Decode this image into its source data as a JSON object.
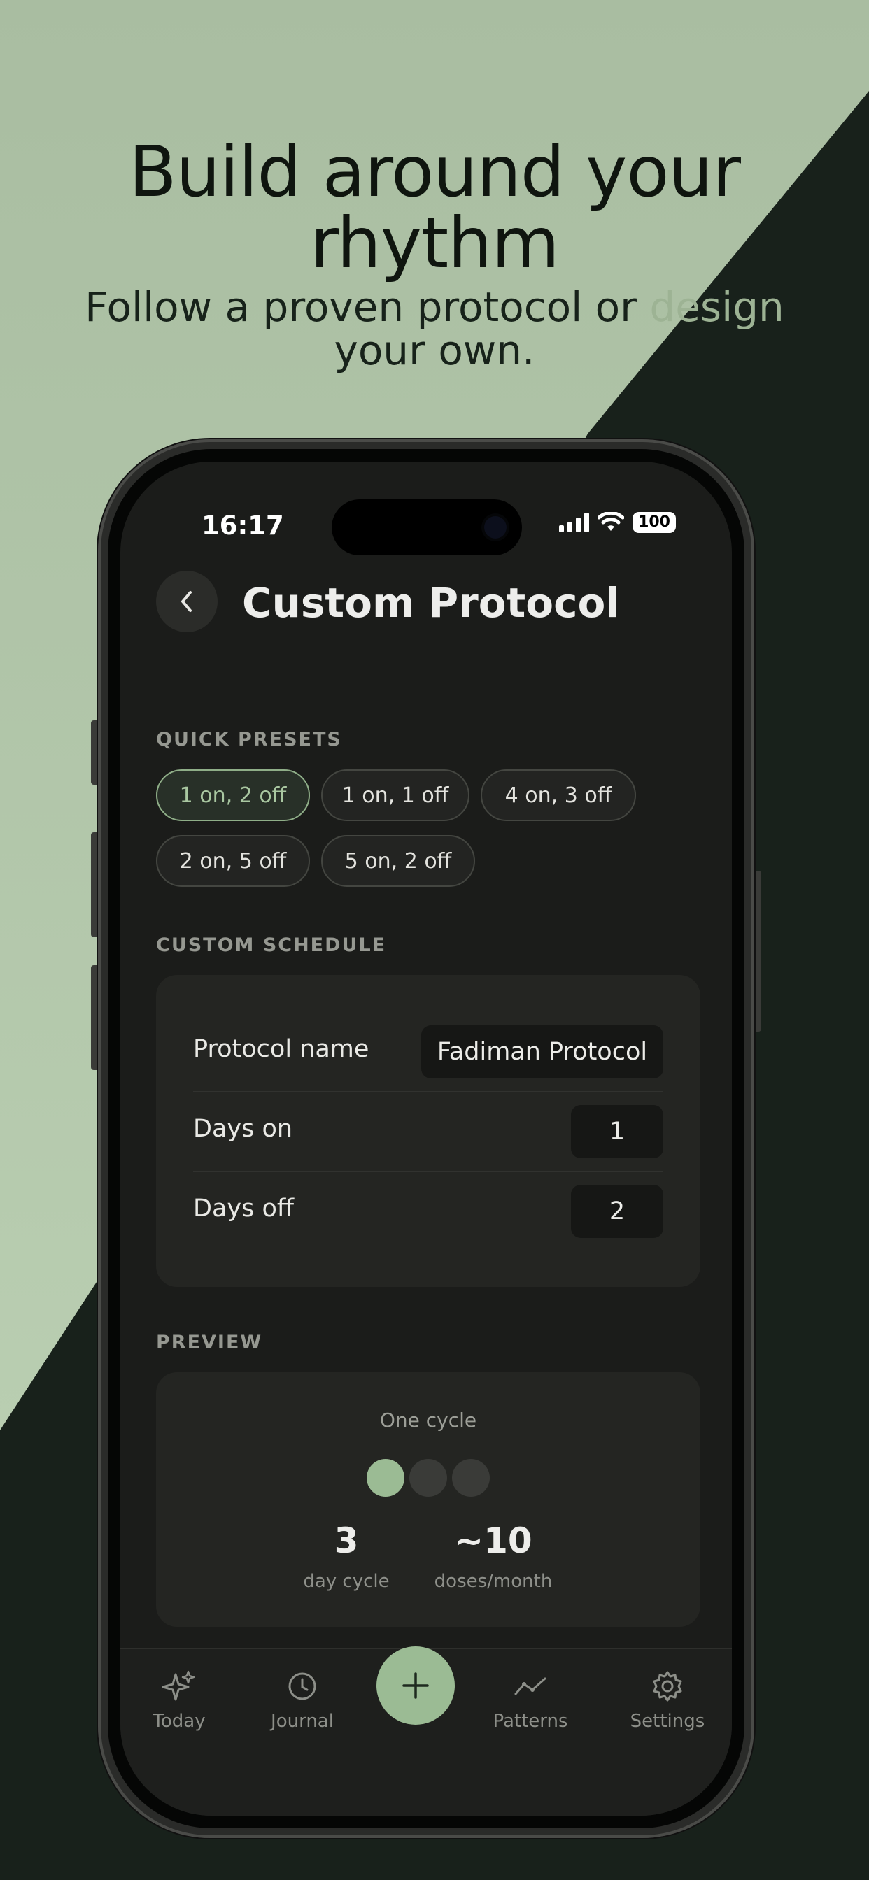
{
  "promo": {
    "headline_line1": "Build around your",
    "headline_line2": "rhythm",
    "sub_part1": "Follow a proven protocol or ",
    "sub_part2": "design",
    "sub_line2": "your own.",
    "colors": {
      "sage": "#a9bea1",
      "dark": "#18211b"
    }
  },
  "status": {
    "time": "16:17",
    "battery": "100"
  },
  "header": {
    "title": "Custom Protocol",
    "back_icon": "chevron-left-icon"
  },
  "presets": {
    "label": "QUICK PRESETS",
    "items": [
      "1 on, 2 off",
      "1 on, 1 off",
      "4 on, 3 off",
      "2 on, 5 off",
      "5 on, 2 off"
    ],
    "selected": "1 on, 2 off"
  },
  "custom": {
    "label": "CUSTOM SCHEDULE",
    "protocol_name_label": "Protocol name",
    "protocol_name_value": "Fadiman Protocol",
    "days_on_label": "Days on",
    "days_on_value": "1",
    "days_off_label": "Days off",
    "days_off_value": "2"
  },
  "preview": {
    "label": "PREVIEW",
    "caption": "One cycle",
    "cycle_days": [
      "on",
      "off",
      "off"
    ],
    "stat1_value": "3",
    "stat1_label": "day cycle",
    "stat2_value": "~10",
    "stat2_label": "doses/month"
  },
  "tabbar": {
    "items": [
      {
        "label": "Today",
        "icon": "sparkles-icon"
      },
      {
        "label": "Journal",
        "icon": "clock-icon"
      },
      {
        "label": "Patterns",
        "icon": "trend-line-icon"
      },
      {
        "label": "Settings",
        "icon": "gear-icon"
      }
    ],
    "add_icon": "plus-icon"
  },
  "accent": "#9bbb94"
}
